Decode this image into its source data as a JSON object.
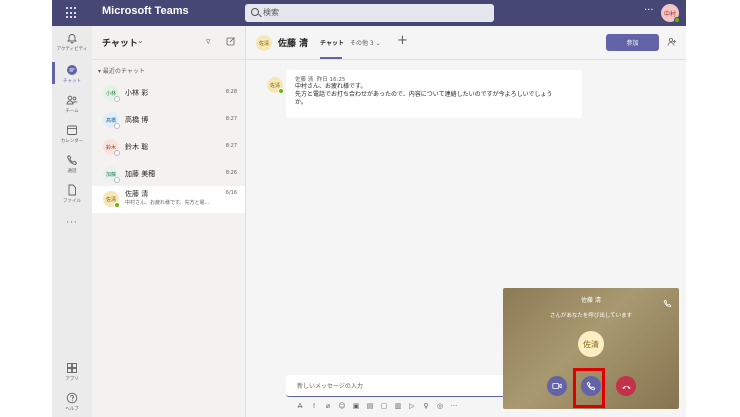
{
  "app": {
    "title": "Microsoft Teams"
  },
  "search": {
    "placeholder": "検索"
  },
  "header": {
    "more": "···",
    "avatar_initials": "中村"
  },
  "rail": {
    "items": [
      {
        "label": "アクティビティ",
        "icon": "bell-icon"
      },
      {
        "label": "チャット",
        "icon": "chat-icon"
      },
      {
        "label": "チーム",
        "icon": "teams-icon"
      },
      {
        "label": "カレンダー",
        "icon": "calendar-icon"
      },
      {
        "label": "通話",
        "icon": "phone-icon"
      },
      {
        "label": "ファイル",
        "icon": "file-icon"
      }
    ],
    "more": "···",
    "apps_label": "アプリ",
    "help_label": "ヘルプ"
  },
  "chatlist": {
    "title": "チャット",
    "section": "最近のチャット",
    "items": [
      {
        "initials": "小林",
        "name": "小林 彩",
        "time": "8:28",
        "preview": "",
        "avatar_bg": "#e3f2e8",
        "avatar_fg": "#2b7a45"
      },
      {
        "initials": "高橋",
        "name": "高橋 博",
        "time": "8:27",
        "preview": "",
        "avatar_bg": "#e0eef9",
        "avatar_fg": "#1f5f93"
      },
      {
        "initials": "鈴木",
        "name": "鈴木 聡",
        "time": "8:27",
        "preview": "",
        "avatar_bg": "#fbe2dc",
        "avatar_fg": "#a23a1c"
      },
      {
        "initials": "加藤",
        "name": "加藤 美穂",
        "time": "8:26",
        "preview": "",
        "avatar_bg": "#e6f3ee",
        "avatar_fg": "#2b7a5b"
      },
      {
        "initials": "佐清",
        "name": "佐藤 清",
        "time": "6/16",
        "preview": "中村さん、お疲れ様です。先方と電...",
        "avatar_bg": "#f6e8b6",
        "avatar_fg": "#7a5c00"
      }
    ]
  },
  "main": {
    "avatar_initials": "佐清",
    "contact_name": "佐藤 清",
    "tab_chat": "チャット",
    "tab_more": "その他 3 ⌄",
    "join_label": "参加",
    "message": {
      "sender": "佐藤 清",
      "time": "昨日 16:25",
      "lines": [
        "中村さん、お疲れ様です。",
        "先方と電話でお打ち合わせがあったので、内容について連絡したいのですが今よろしいでしょう",
        "か。"
      ]
    },
    "composer_placeholder": "新しいメッセージの入力"
  },
  "call": {
    "caller": "佐藤 清",
    "status": "さんがあなたを呼び出しています",
    "initials": "佐清"
  },
  "colors": {
    "brand": "#6264a7",
    "titlebar": "#464775",
    "decline": "#c4314b",
    "highlight": "#e00000"
  }
}
